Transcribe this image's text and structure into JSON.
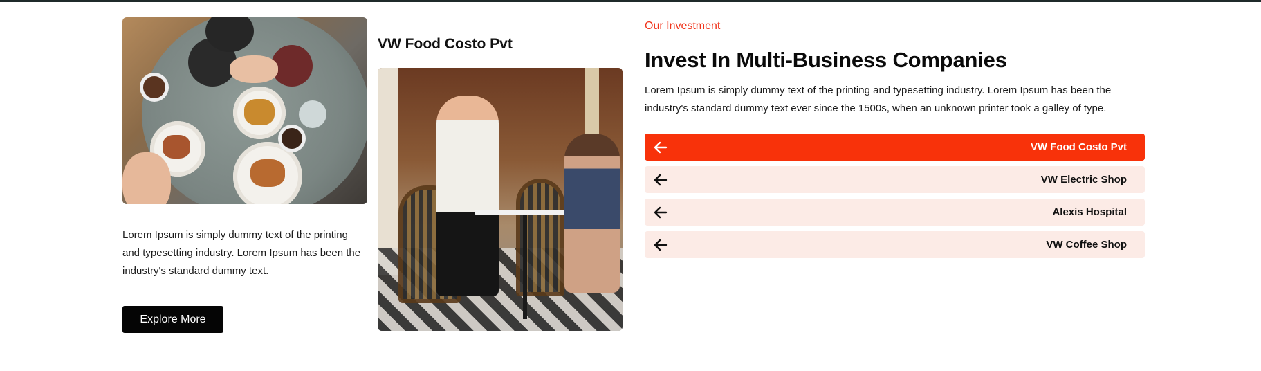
{
  "left": {
    "image_icon": "dining-table-photo",
    "description": "Lorem Ipsum is simply dummy text of the printing and typesetting industry. Lorem Ipsum has been the industry's standard dummy text.",
    "explore_button": "Explore More"
  },
  "middle": {
    "title": "VW Food Costo Pvt",
    "image_icon": "waiter-cafe-photo"
  },
  "right": {
    "eyebrow": "Our Investment",
    "headline": "Invest In Multi-Business Companies",
    "lead": "Lorem Ipsum is simply dummy text of the printing and typesetting industry. Lorem Ipsum has been the industry's standard dummy text ever since the 1500s, when an unknown printer took a galley of type.",
    "companies": [
      {
        "label": "VW Food Costo Pvt",
        "icon": "arrow-left-icon",
        "active": true
      },
      {
        "label": "VW Electric Shop",
        "icon": "arrow-left-icon",
        "active": false
      },
      {
        "label": "Alexis Hospital",
        "icon": "arrow-left-icon",
        "active": false
      },
      {
        "label": "VW Coffee Shop",
        "icon": "arrow-left-icon",
        "active": false
      }
    ]
  },
  "colors": {
    "accent": "#f8320a",
    "accent_text": "#f0341b",
    "item_bg": "#fcebe6",
    "button_bg": "#050505",
    "top_rule": "#1f2a2a"
  }
}
